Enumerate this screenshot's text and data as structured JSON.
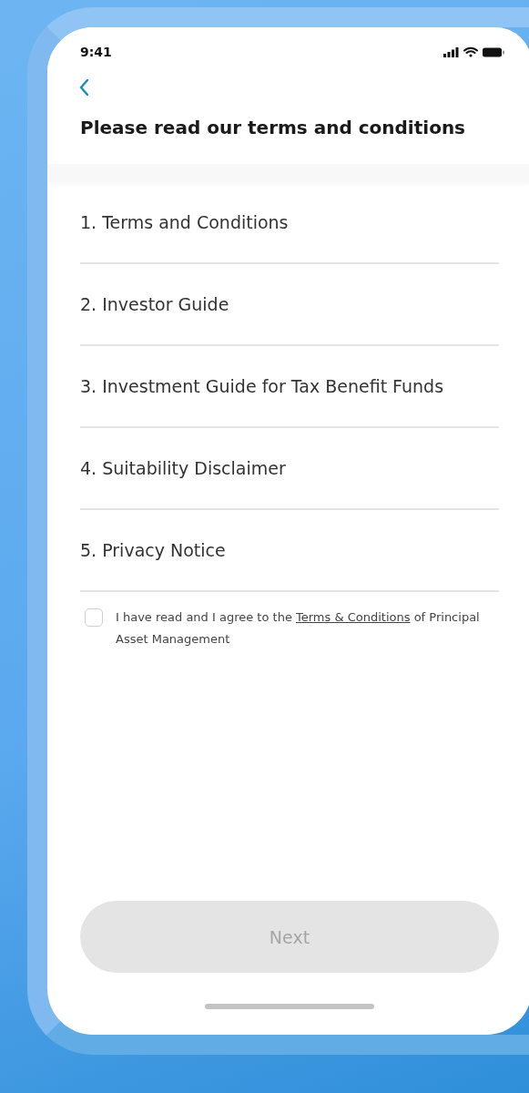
{
  "status_bar": {
    "time": "9:41"
  },
  "header": {
    "title": "Please read our terms and conditions"
  },
  "documents": [
    {
      "label": "1. Terms and Conditions"
    },
    {
      "label": "2. Investor Guide"
    },
    {
      "label": "3. Investment Guide for Tax Benefit Funds"
    },
    {
      "label": "4. Suitability Disclaimer"
    },
    {
      "label": "5. Privacy Notice"
    }
  ],
  "agreement": {
    "checked": false,
    "text_before": "I have read and I agree to the ",
    "link": "Terms & Conditions",
    "text_after": " of Principal Asset Management"
  },
  "next_button": {
    "label": "Next",
    "disabled": true
  }
}
